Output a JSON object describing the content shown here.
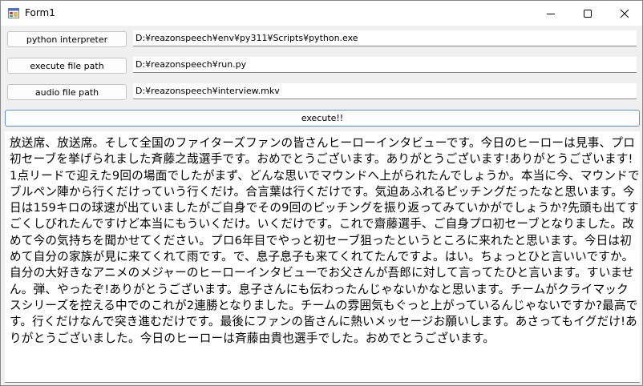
{
  "window": {
    "title": "Form1"
  },
  "rows": [
    {
      "button_label": "python interpreter",
      "value": "D:¥reazonspeech¥env¥py311¥Scripts¥python.exe"
    },
    {
      "button_label": "execute file path",
      "value": "D:¥reazonspeech¥run.py"
    },
    {
      "button_label": "audio file path",
      "value": "D:¥reazonspeech¥interview.mkv"
    }
  ],
  "execute": {
    "label": "execute!!"
  },
  "output": {
    "text": "放送席、放送席。そして全国のファイターズファンの皆さんヒーローインタビューです。今日のヒーローは見事、プロ初セーブを挙げられました斉藤之哉選手です。おめでとうございます。ありがとうございます!ありがとうございます!1点リードで迎えた9回の場面でしたがまず、どんな思いでマウンドへ上がられたんでしょうか。本当に今、マウンドでブルペン陣から行くだけっていう行くだけ。合言葉は行くだけです。気迫あふれるピッチングだったなと思います。今日は159キロの球速が出ていましたがご自身でその9回のピッチングを振り返ってみていかがでしょうか?先頭も出てすごくしびれたんですけど本当にもういくだけ。いくだけです。これで齋藤選手、ご自身プロ初セーブとなりました。改めて今の気持ちを聞かせてください。プロ6年目でやっと初セーブ狙ったというところに来れたと思います。今日は初めて自分の家族が見に来てくれて雨です。で、息子息子も来てくれてたんですよ。はい。ちょっとひと言いいですか。自分の大好きなアニメのメジャーのヒーローインタビューでお父さんが吾郎に対して言ってたひと言います。すいません。弾、やったぞ!ありがとうございます。息子さんにも伝わったんじゃないかなと思います。チームがクライマックスシリーズを控える中でのこれが2連勝となりました。チームの雰囲気もぐっと上がっているんじゃないですか?最高です。行くだけなんで突き進むだけです。最後にファンの皆さんに熱いメッセージお願いします。あさってもイグだけ!ありがとうございました。今日のヒーローは斉藤由貴也選手でした。おめでとうございます。"
  },
  "icons": {
    "app": "form-app-icon",
    "minimize": "minimize-icon",
    "maximize": "maximize-icon",
    "close": "close-icon"
  },
  "colors": {
    "accent_border": "#5b8fd6",
    "window_bg": "#f0f0f0"
  }
}
